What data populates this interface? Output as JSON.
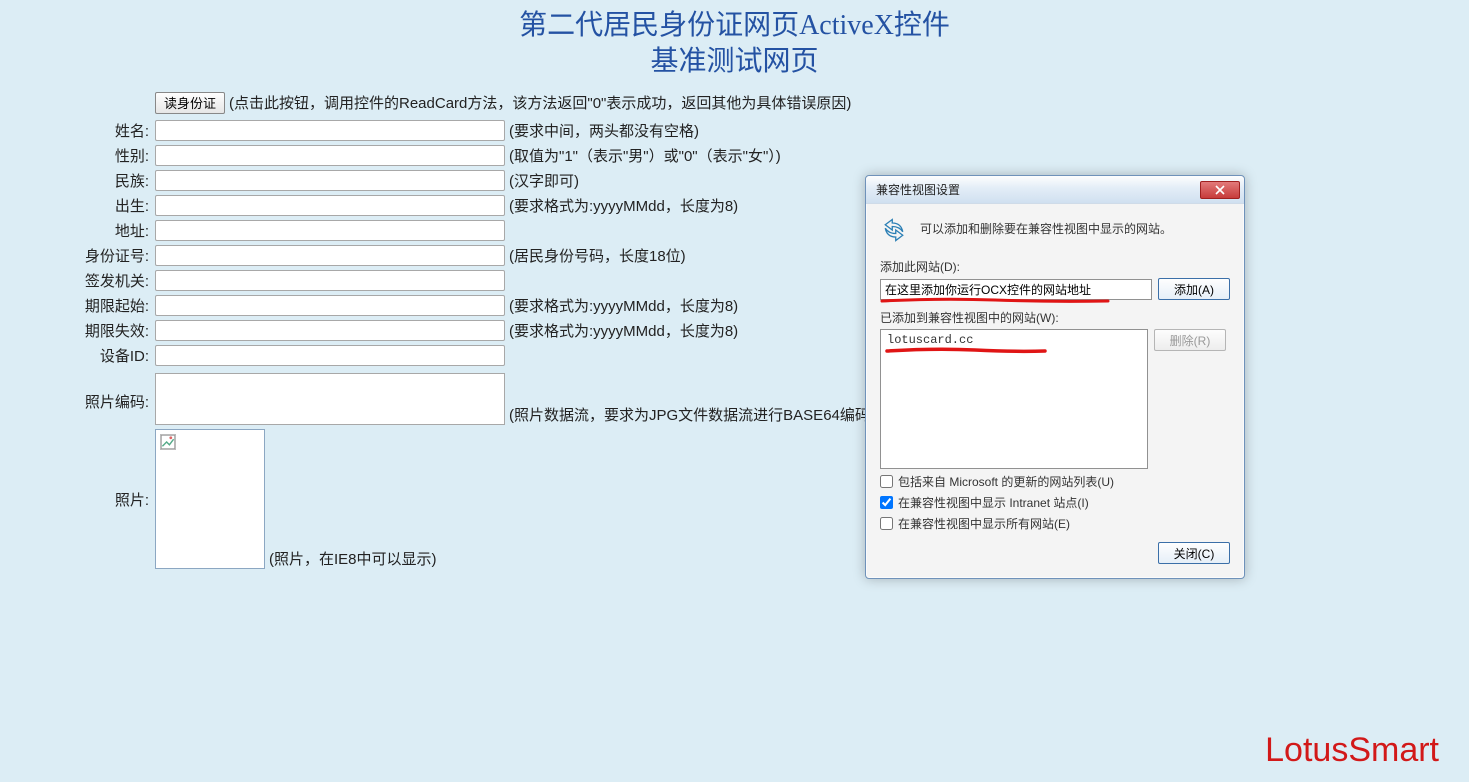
{
  "header": {
    "line1": "第二代居民身份证网页ActiveX控件",
    "line2": "基准测试网页"
  },
  "form": {
    "read_button": "读身份证",
    "read_hint": "(点击此按钮，调用控件的ReadCard方法，该方法返回\"0\"表示成功，返回其他为具体错误原因)",
    "fields": {
      "name": {
        "label": "姓名:",
        "hint": "(要求中间，两头都没有空格)"
      },
      "gender": {
        "label": "性别:",
        "hint": "(取值为\"1\"（表示\"男\"）或\"0\"（表示\"女\"）)"
      },
      "nation": {
        "label": "民族:",
        "hint": "(汉字即可)"
      },
      "birth": {
        "label": "出生:",
        "hint": "(要求格式为:yyyyMMdd，长度为8)"
      },
      "address": {
        "label": "地址:",
        "hint": ""
      },
      "idno": {
        "label": "身份证号:",
        "hint": "(居民身份号码，长度18位)"
      },
      "issuer": {
        "label": "签发机关:",
        "hint": ""
      },
      "start": {
        "label": "期限起始:",
        "hint": "(要求格式为:yyyyMMdd，长度为8)"
      },
      "end": {
        "label": "期限失效:",
        "hint": "(要求格式为:yyyyMMdd，长度为8)"
      },
      "device": {
        "label": "设备ID:",
        "hint": ""
      }
    },
    "photo_encode_label": "照片编码:",
    "photo_encode_hint": "(照片数据流，要求为JPG文件数据流进行BASE64编码",
    "photo_label": "照片:",
    "photo_hint": "(照片，在IE8中可以显示)"
  },
  "dialog": {
    "title": "兼容性视图设置",
    "description": "可以添加和删除要在兼容性视图中显示的网站。",
    "add_label": "添加此网站(D):",
    "add_value": "在这里添加你运行OCX控件的网站地址",
    "add_button": "添加(A)",
    "list_label": "已添加到兼容性视图中的网站(W):",
    "list_item": "lotuscard.cc",
    "delete_button": "删除(R)",
    "checkbox1": "包括来自 Microsoft 的更新的网站列表(U)",
    "checkbox2": "在兼容性视图中显示 Intranet 站点(I)",
    "checkbox3": "在兼容性视图中显示所有网站(E)",
    "close_button": "关闭(C)"
  },
  "brand": "LotusSmart"
}
